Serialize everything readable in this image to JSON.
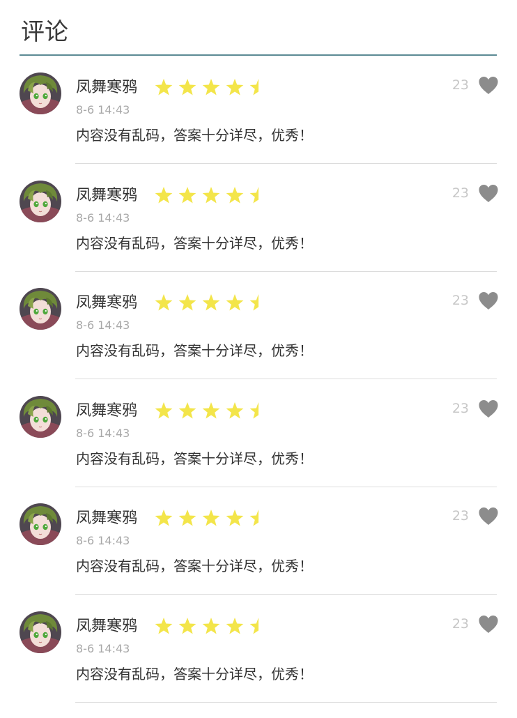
{
  "header": {
    "title": "评论"
  },
  "colors": {
    "accent": "#5b8a94",
    "star": "#f3e54a",
    "heart": "#8c8c8c",
    "count": "#c7c7c7",
    "time": "#a8a8a8"
  },
  "comments": [
    {
      "name": "凤舞寒鸦",
      "rating": 4.5,
      "time": "8-6 14:43",
      "text": "内容没有乱码，答案十分详尽，优秀！",
      "likes": "23",
      "avatar_icon": "anime-avatar",
      "like_icon": "heart-icon"
    },
    {
      "name": "凤舞寒鸦",
      "rating": 4.5,
      "time": "8-6 14:43",
      "text": "内容没有乱码，答案十分详尽，优秀！",
      "likes": "23",
      "avatar_icon": "anime-avatar",
      "like_icon": "heart-icon"
    },
    {
      "name": "凤舞寒鸦",
      "rating": 4.5,
      "time": "8-6 14:43",
      "text": "内容没有乱码，答案十分详尽，优秀！",
      "likes": "23",
      "avatar_icon": "anime-avatar",
      "like_icon": "heart-icon"
    },
    {
      "name": "凤舞寒鸦",
      "rating": 4.5,
      "time": "8-6 14:43",
      "text": "内容没有乱码，答案十分详尽，优秀！",
      "likes": "23",
      "avatar_icon": "anime-avatar",
      "like_icon": "heart-icon"
    },
    {
      "name": "凤舞寒鸦",
      "rating": 4.5,
      "time": "8-6 14:43",
      "text": "内容没有乱码，答案十分详尽，优秀！",
      "likes": "23",
      "avatar_icon": "anime-avatar",
      "like_icon": "heart-icon"
    },
    {
      "name": "凤舞寒鸦",
      "rating": 4.5,
      "time": "8-6 14:43",
      "text": "内容没有乱码，答案十分详尽，优秀！",
      "likes": "23",
      "avatar_icon": "anime-avatar",
      "like_icon": "heart-icon"
    }
  ]
}
